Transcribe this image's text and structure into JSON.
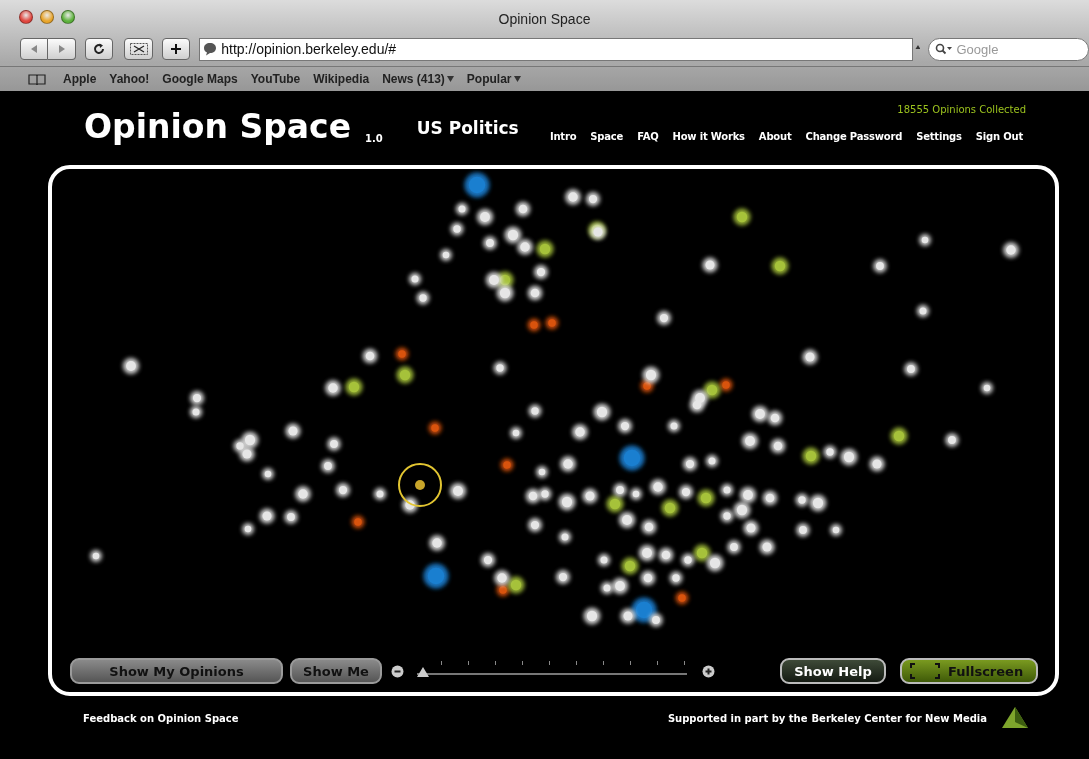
{
  "window": {
    "title": "Opinion Space"
  },
  "toolbar": {
    "url": "http://opinion.berkeley.edu/#",
    "search_placeholder": "Google"
  },
  "bookmarks": [
    {
      "label": "Apple",
      "menu": false
    },
    {
      "label": "Yahoo!",
      "menu": false
    },
    {
      "label": "Google Maps",
      "menu": false
    },
    {
      "label": "YouTube",
      "menu": false
    },
    {
      "label": "Wikipedia",
      "menu": false
    },
    {
      "label": "News (413)",
      "menu": true
    },
    {
      "label": "Popular",
      "menu": true
    }
  ],
  "header": {
    "logo": "Opinion Space",
    "version": "1.0",
    "topic": "US Politics",
    "count": "18555 Opinions Collected",
    "nav": [
      "Intro",
      "Space",
      "FAQ",
      "How it Works",
      "About",
      "Change Password",
      "Settings",
      "Sign Out"
    ]
  },
  "space": {
    "show_my_opinions": "Show My Opinions",
    "show_me": "Show Me",
    "zoom": {
      "level": 0
    },
    "show_help": "Show Help",
    "fullscreen": "Fullscreen"
  },
  "footer": {
    "feedback": "Feedback on Opinion Space",
    "support": "Supported in part by the",
    "sponsor": "Berkeley Center for New Media"
  }
}
